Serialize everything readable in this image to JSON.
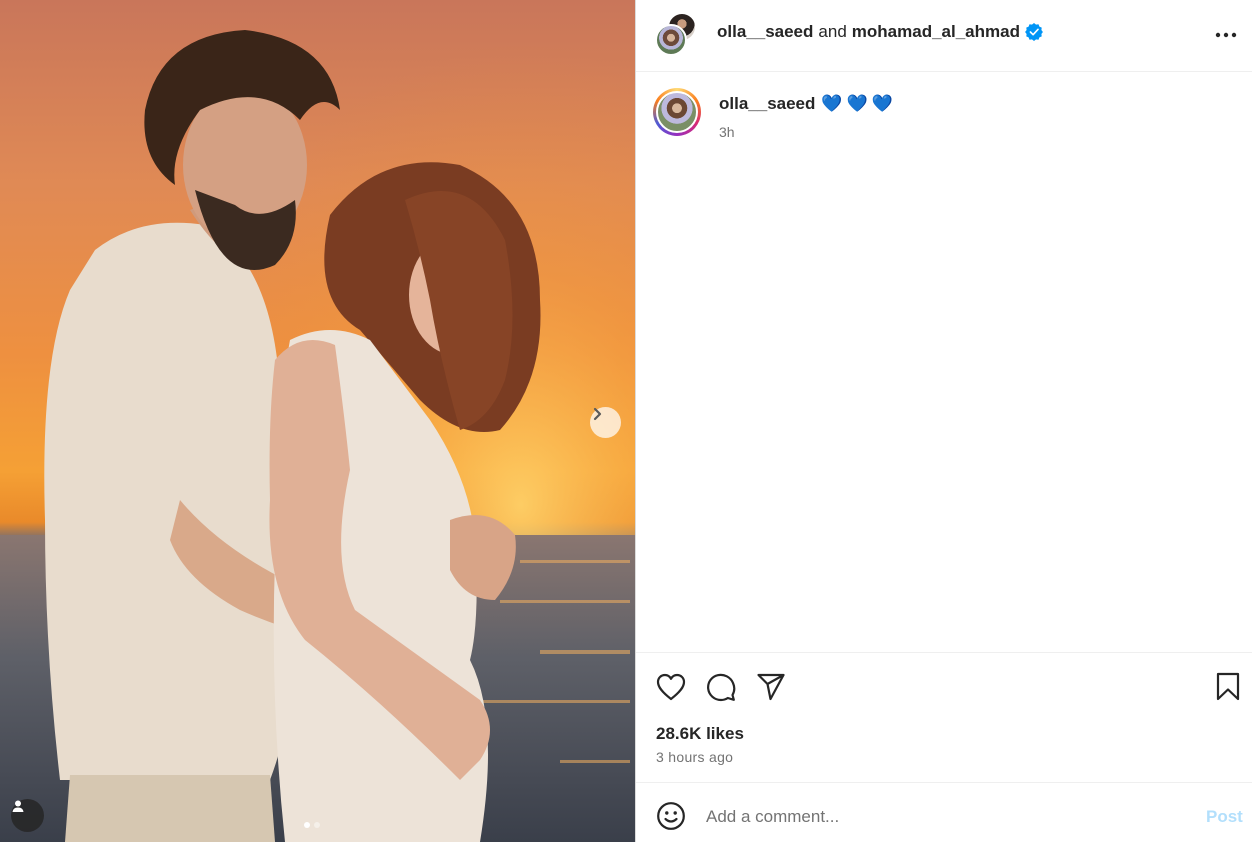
{
  "post": {
    "media": {
      "carousel_total": 2,
      "carousel_current": 1,
      "next_icon": "chevron-right-icon",
      "tag_icon": "user-tag-icon"
    },
    "header": {
      "author": "olla__saeed",
      "conjunction": "and",
      "collaborator": "mohamad_al_ahmad",
      "verified_icon": "verified-badge-icon",
      "more_icon": "more-options-icon"
    },
    "caption": {
      "username": "olla__saeed",
      "text": "💙💙💙",
      "time": "3h"
    },
    "actions": {
      "like_icon": "heart-icon",
      "comment_icon": "comment-icon",
      "share_icon": "share-icon",
      "save_icon": "bookmark-icon"
    },
    "likes": "28.6K likes",
    "posted_ago": "3 hours ago",
    "comment": {
      "emoji_icon": "emoji-icon",
      "placeholder": "Add a comment...",
      "value": "",
      "post_label": "Post"
    },
    "colors": {
      "verified": "#0095f6",
      "post_disabled": "#b2dffc",
      "secondary_text": "#737373",
      "heart_emoji": "#5aaee8"
    }
  }
}
